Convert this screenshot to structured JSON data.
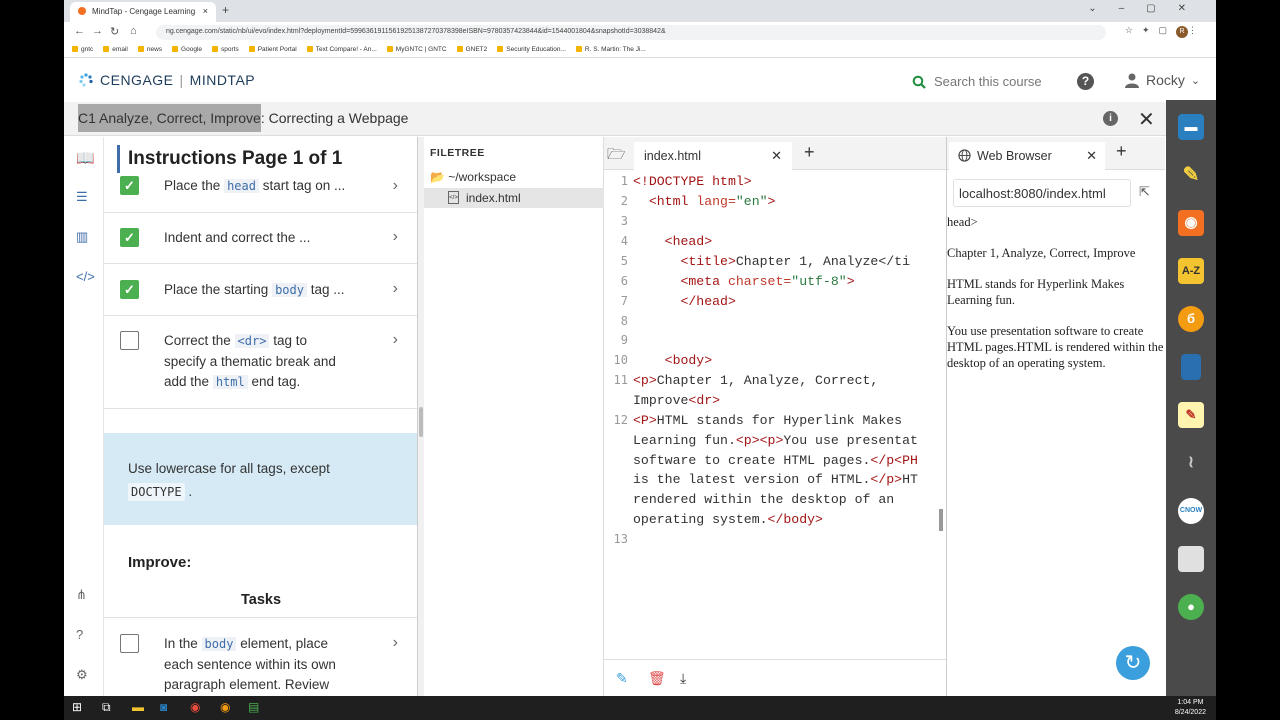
{
  "browser": {
    "tab_title": "MindTap - Cengage Learning",
    "url": "ng.cengage.com/static/nb/ui/evo/index.html?deploymentId=59963619115619251387270378398eISBN=9780357423844&id=1544001804&snapshotId=3038842&",
    "bookmarks": [
      "gntc",
      "email",
      "news",
      "Google",
      "sports",
      "Patient Portal",
      "Text Compare! - An...",
      "MyGNTC | GNTC",
      "GNET2",
      "Security Education...",
      "R. S. Martin: The Ji..."
    ],
    "profile_initial": "R"
  },
  "header": {
    "brand": "CENGAGE",
    "product": "MINDTAP",
    "search_label": "Search this course",
    "user_name": "Rocky"
  },
  "activity": {
    "title_highlight": "C1 Analyze, Correct, Improve",
    "title_rest": ": Correcting a Webpage"
  },
  "instructions": {
    "title": "Instructions Page 1 of 1",
    "tasks": [
      {
        "pre": "Place the",
        "code": "head",
        "post": "start tag on ...",
        "done": true
      },
      {
        "pre": "Indent and correct the ...",
        "code": "",
        "post": "",
        "done": true
      },
      {
        "pre": "Place the starting",
        "code": "body",
        "post": "tag ...",
        "done": true
      }
    ],
    "task4": {
      "l1_pre": "Correct the",
      "l1_code": "<dr>",
      "l1_post": "tag to",
      "l2": "specify a thematic break and",
      "l3_pre": "add the",
      "l3_code": "html",
      "l3_post": "end tag.",
      "done": false
    },
    "tip_pre": "Use lowercase for all tags, except",
    "tip_code": "DOCTYPE",
    "tip_post": ".",
    "improve_label": "Improve:",
    "tasks_label": "Tasks",
    "task5": {
      "l1_pre": "In the",
      "l1_code": "body",
      "l1_post": "element, place",
      "l2": "each sentence within its own",
      "l3": "paragraph element. Review",
      "done": false
    }
  },
  "filetree": {
    "header": "FILETREE",
    "workspace": "~/workspace",
    "file": "index.html"
  },
  "editor": {
    "tab": "index.html",
    "line_numbers": [
      "1",
      "2",
      "3",
      "4",
      "5",
      "6",
      "7",
      "8",
      "9",
      "10",
      "11",
      "12",
      "13"
    ],
    "lines": {
      "l1": "<!DOCTYPE html>",
      "l2a": "  <html ",
      "l2b": "lang=",
      "l2c": "\"en\"",
      "l2d": ">",
      "l4": "    <head>",
      "l5a": "      <title>",
      "l5b": "Chapter 1, Analyze</ti",
      "l6a": "      <meta ",
      "l6b": "charset=",
      "l6c": "\"utf-8\"",
      "l6d": ">",
      "l7": "      </head>",
      "l10": "    <body>",
      "l11a": "<p>",
      "l11b": "Chapter 1, Analyze, Correct,",
      "l11c": "Improve",
      "l11d": "<dr>",
      "l12a": "<P>",
      "l12b": "HTML stands for Hyperlink Makes",
      "l12c": "Learning fun.",
      "l12d": "<p><p>",
      "l12e": "You use presentat",
      "l12f": "software to create HTML pages.",
      "l12g": "</p<PH",
      "l12h": "is the latest version of HTML.",
      "l12i": "</p>",
      "l12j": "HT",
      "l12k": "rendered within the desktop of an",
      "l12l": "operating system.",
      "l12m": "</body>"
    }
  },
  "web_browser": {
    "tab": "Web Browser",
    "url": "localhost:8080/index.html",
    "content": [
      "head>",
      "Chapter 1, Analyze, Correct, Improve",
      "HTML stands for Hyperlink Makes Learning fun.",
      "You use presentation software to create HTML pages.HTML is rendered within the desktop of an operating system."
    ]
  },
  "dock": {
    "az_label": "A-Z",
    "cnow_label": "CNOW"
  },
  "taskbar": {
    "time": "1:04 PM",
    "date": "8/24/2022"
  },
  "colors": {
    "accent_blue": "#3f6da8",
    "check_green": "#4caf50",
    "tip_bg": "#d5eaf5",
    "search_green": "#1e8e3e"
  }
}
